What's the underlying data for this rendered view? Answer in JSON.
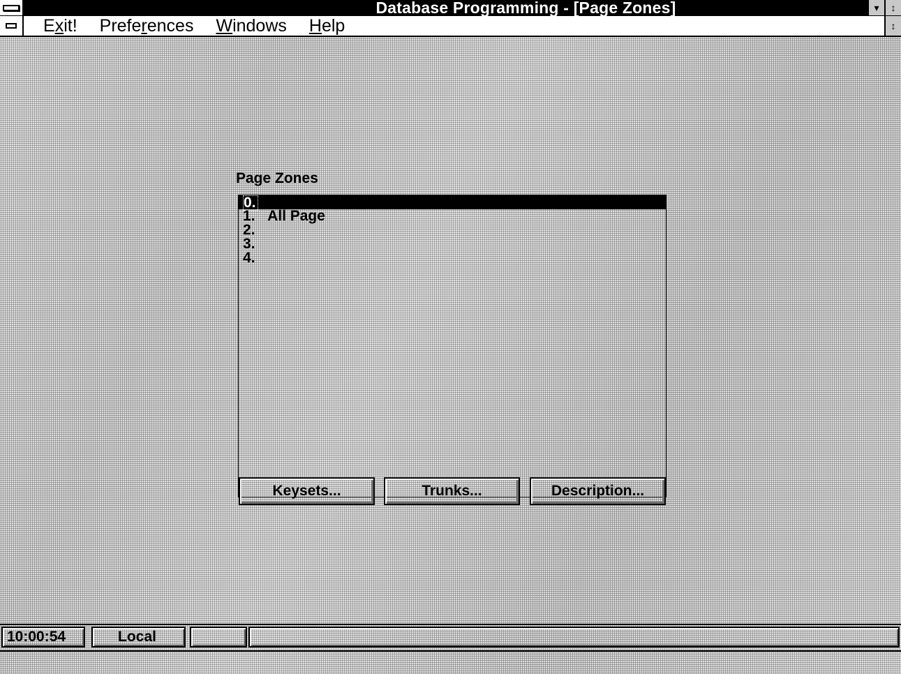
{
  "window": {
    "title": "Database Programming - [Page Zones]",
    "scroll_glyph": "↕",
    "minimize_glyph": "▾"
  },
  "menu": {
    "items": [
      {
        "label": "Exit!",
        "mnemonic_index": 1
      },
      {
        "label": "Preferences",
        "mnemonic_index": 5
      },
      {
        "label": "Windows",
        "mnemonic_index": 0
      },
      {
        "label": "Help",
        "mnemonic_index": 0
      }
    ]
  },
  "dialog": {
    "label": "Page Zones",
    "list": [
      {
        "num": "0.",
        "text": "",
        "selected": true
      },
      {
        "num": "1.",
        "text": "All Page",
        "selected": false
      },
      {
        "num": "2.",
        "text": "",
        "selected": false
      },
      {
        "num": "3.",
        "text": "",
        "selected": false
      },
      {
        "num": "4.",
        "text": "",
        "selected": false
      }
    ],
    "buttons": {
      "keysets": "Keysets...",
      "trunks": "Trunks...",
      "description": "Description..."
    }
  },
  "status": {
    "time": "10:00:54",
    "mode": "Local"
  },
  "icons": {
    "system_menu": "system-menu-icon",
    "doc_menu": "document-menu-icon"
  }
}
